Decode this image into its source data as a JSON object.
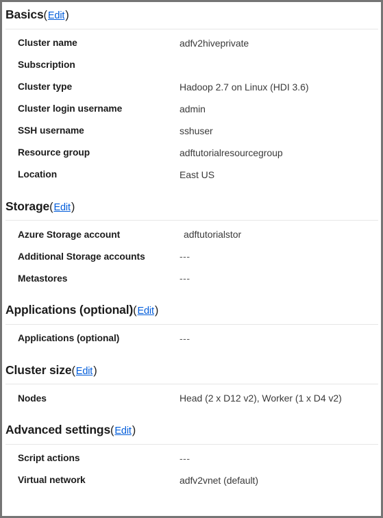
{
  "panel": {
    "name": "cluster-summary-panel",
    "edit_label": "Edit",
    "open_paren": "(",
    "close_paren": ")",
    "accent_link_color": "#015cda",
    "border_color": "#757575",
    "divider_color": "#e6e6e6"
  },
  "sections": [
    {
      "id": "basics",
      "title": "Basics",
      "edit_label": "Edit",
      "rows": [
        {
          "label": "Cluster name",
          "value": "adfv2hiveprivate"
        },
        {
          "label": "Subscription",
          "value": ""
        },
        {
          "label": "Cluster type",
          "value": "Hadoop 2.7 on Linux (HDI 3.6)"
        },
        {
          "label": "Cluster login username",
          "value": "admin"
        },
        {
          "label": "SSH username",
          "value": "sshuser"
        },
        {
          "label": "Resource group",
          "value": "adftutorialresourcegroup"
        },
        {
          "label": "Location",
          "value": "East US"
        }
      ]
    },
    {
      "id": "storage",
      "title": "Storage",
      "edit_label": "Edit",
      "rows": [
        {
          "label": "Azure Storage account",
          "value": "adftutorialstor"
        },
        {
          "label": "Additional Storage accounts",
          "value": "---"
        },
        {
          "label": "Metastores",
          "value": "---"
        }
      ]
    },
    {
      "id": "applications",
      "title": "Applications (optional)",
      "edit_label": "Edit",
      "rows": [
        {
          "label": "Applications (optional)",
          "value": "---"
        }
      ]
    },
    {
      "id": "cluster-size",
      "title": "Cluster size",
      "edit_label": "Edit",
      "rows": [
        {
          "label": "Nodes",
          "value": "Head (2 x D12 v2), Worker (1 x D4 v2)"
        }
      ]
    },
    {
      "id": "advanced-settings",
      "title": "Advanced settings",
      "edit_label": "Edit",
      "rows": [
        {
          "label": "Script actions",
          "value": "---"
        },
        {
          "label": "Virtual network",
          "value": "adfv2vnet (default)"
        }
      ]
    }
  ]
}
